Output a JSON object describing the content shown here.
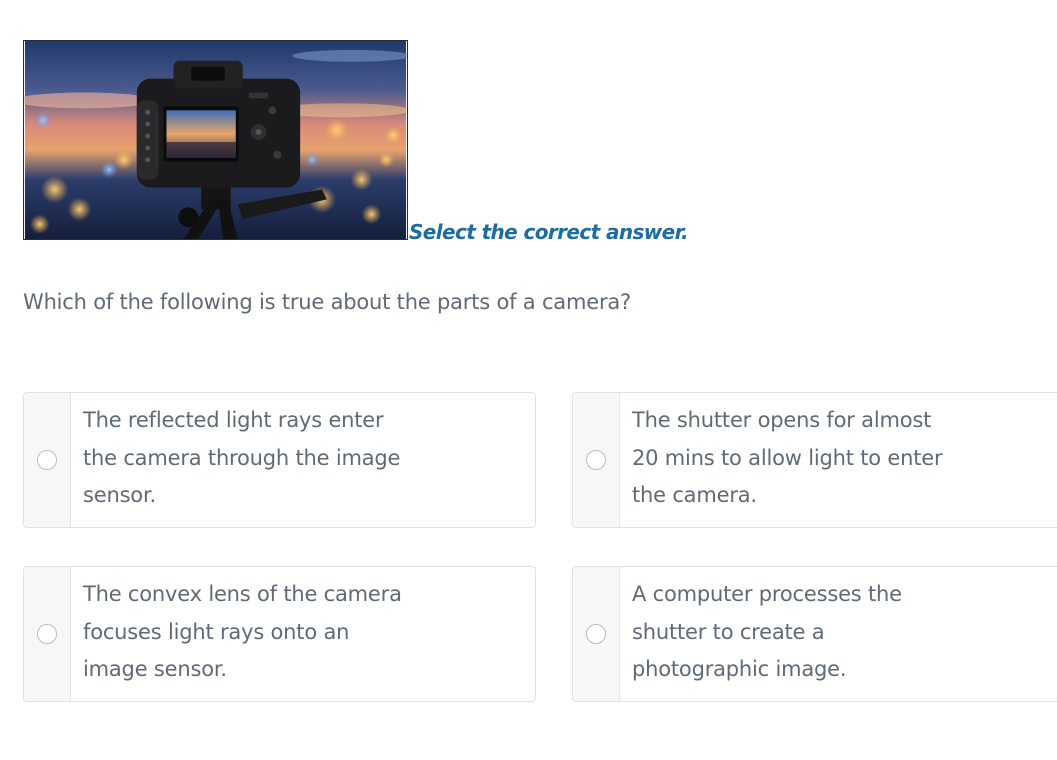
{
  "instruction": "Select the correct answer.",
  "question": "Which of the following is true about the parts of a camera?",
  "options": [
    {
      "text": "The reflected light rays enter the camera through the image sensor.",
      "selected": false
    },
    {
      "text": "The shutter opens for almost 20 mins to allow light to enter the camera.",
      "selected": false
    },
    {
      "text": "The convex lens of the camera focuses light rays onto an image sensor.",
      "selected": false
    },
    {
      "text": "A computer processes the shutter to create a photographic image.",
      "selected": false
    }
  ],
  "colors": {
    "instruction": "#1d6d9e",
    "body_text": "#5f6a75",
    "option_border": "#dfe2e6",
    "radio_column": "#f7f7f8"
  },
  "image": {
    "subject": "dslr-camera-on-tripod-with-city-bokeh"
  }
}
